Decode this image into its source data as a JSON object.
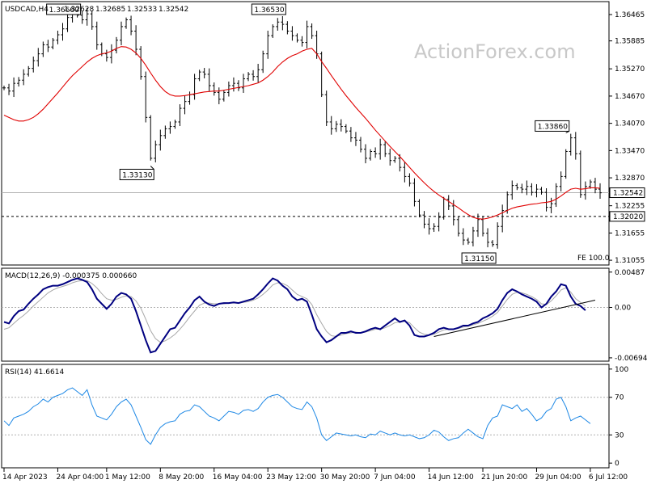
{
  "chart_data": [
    {
      "type": "line",
      "panel": "price",
      "title": "USDCAD,H4",
      "ohlc": [
        "1.32628",
        "1.32685",
        "1.32533",
        "1.32542"
      ],
      "watermark": "ActionForex.com",
      "ylim": [
        1.3095,
        1.3675
      ],
      "y_ticks": [
        "1.36465",
        "1.35885",
        "1.35270",
        "1.34670",
        "1.34070",
        "1.33470",
        "1.32870",
        "1.32255",
        "1.31655",
        "1.31055"
      ],
      "y_tick_values": [
        1.36465,
        1.35885,
        1.3527,
        1.3467,
        1.3407,
        1.3347,
        1.3287,
        1.32255,
        1.31655,
        1.31055
      ],
      "current_label": "1.32542",
      "current_value": 1.32542,
      "level_label": "1.32020",
      "level_value": 1.3202,
      "fib_label": "FE 100.0",
      "annotations": [
        {
          "text": "1.36660",
          "i": 15,
          "value": 1.3666,
          "side": "high"
        },
        {
          "text": "1.33130",
          "i": 30,
          "value": 1.3313,
          "side": "low"
        },
        {
          "text": "1.36530",
          "i": 57,
          "value": 1.3653,
          "side": "high"
        },
        {
          "text": "1.31150",
          "i": 100,
          "value": 1.3115,
          "side": "low"
        },
        {
          "text": "1.33860",
          "i": 115,
          "value": 1.3386,
          "side": "high"
        }
      ],
      "x_labels": [
        "14 Apr 2023",
        "24 Apr 04:00",
        "1 May 12:00",
        "8 May 20:00",
        "16 May 04:00",
        "23 May 12:00",
        "30 May 20:00",
        "7 Jun 04:00",
        "14 Jun 12:00",
        "21 Jun 20:00",
        "29 Jun 04:00",
        "6 Jul 12:00"
      ],
      "x_label_index": [
        0,
        11,
        21,
        32,
        43,
        54,
        65,
        76,
        87,
        98,
        109,
        120
      ],
      "close": [
        1.3485,
        1.3478,
        1.3495,
        1.3502,
        1.3515,
        1.3528,
        1.3545,
        1.356,
        1.358,
        1.3575,
        1.359,
        1.3602,
        1.3615,
        1.364,
        1.3652,
        1.3645,
        1.3635,
        1.3648,
        1.362,
        1.358,
        1.356,
        1.3552,
        1.3568,
        1.359,
        1.362,
        1.3635,
        1.361,
        1.357,
        1.351,
        1.342,
        1.333,
        1.336,
        1.338,
        1.3395,
        1.34,
        1.341,
        1.344,
        1.3455,
        1.347,
        1.3505,
        1.352,
        1.3515,
        1.349,
        1.3475,
        1.346,
        1.3475,
        1.349,
        1.3495,
        1.3485,
        1.3505,
        1.3515,
        1.351,
        1.3525,
        1.356,
        1.36,
        1.362,
        1.363,
        1.3625,
        1.361,
        1.36,
        1.359,
        1.3585,
        1.362,
        1.36,
        1.356,
        1.347,
        1.341,
        1.3395,
        1.3405,
        1.34,
        1.339,
        1.3375,
        1.337,
        1.335,
        1.333,
        1.3345,
        1.334,
        1.336,
        1.334,
        1.3325,
        1.333,
        1.331,
        1.329,
        1.3275,
        1.3235,
        1.3205,
        1.3185,
        1.3175,
        1.318,
        1.32,
        1.324,
        1.3225,
        1.3195,
        1.3165,
        1.315,
        1.3145,
        1.317,
        1.3195,
        1.3165,
        1.3145,
        1.314,
        1.318,
        1.3215,
        1.325,
        1.327,
        1.3265,
        1.3262,
        1.3268,
        1.3255,
        1.3262,
        1.3255,
        1.3222,
        1.323,
        1.3268,
        1.329,
        1.3345,
        1.3375,
        1.334,
        1.325,
        1.3268,
        1.3278,
        1.3262,
        1.3254
      ],
      "ma": [
        1.3425,
        1.342,
        1.3415,
        1.3412,
        1.3412,
        1.3415,
        1.342,
        1.3428,
        1.3438,
        1.345,
        1.3462,
        1.3474,
        1.3487,
        1.35,
        1.3512,
        1.3522,
        1.3532,
        1.3542,
        1.355,
        1.3556,
        1.356,
        1.3562,
        1.3566,
        1.3572,
        1.3576,
        1.3575,
        1.357,
        1.3562,
        1.355,
        1.3535,
        1.3518,
        1.3502,
        1.3488,
        1.3477,
        1.347,
        1.3467,
        1.3467,
        1.3468,
        1.347,
        1.3472,
        1.3474,
        1.3476,
        1.3477,
        1.3478,
        1.3478,
        1.348,
        1.3482,
        1.3484,
        1.3486,
        1.3488,
        1.349,
        1.3493,
        1.3496,
        1.3502,
        1.351,
        1.352,
        1.3532,
        1.3542,
        1.355,
        1.3556,
        1.356,
        1.3566,
        1.357,
        1.3572,
        1.356,
        1.3543,
        1.3528,
        1.3512,
        1.3497,
        1.3482,
        1.3468,
        1.3455,
        1.3442,
        1.343,
        1.3418,
        1.3405,
        1.3392,
        1.338,
        1.3368,
        1.3356,
        1.3345,
        1.3334,
        1.3322,
        1.331,
        1.3298,
        1.3287,
        1.3276,
        1.3266,
        1.3257,
        1.3249,
        1.3242,
        1.3235,
        1.3228,
        1.3221,
        1.3213,
        1.3206,
        1.32,
        1.3197,
        1.3196,
        1.3198,
        1.3201,
        1.3205,
        1.321,
        1.3215,
        1.322,
        1.3223,
        1.3225,
        1.3227,
        1.3229,
        1.323,
        1.3232,
        1.3233,
        1.3235,
        1.324,
        1.3247,
        1.3255,
        1.3262,
        1.3264,
        1.3262,
        1.3263,
        1.3265,
        1.3265,
        1.3264
      ]
    },
    {
      "type": "line",
      "panel": "macd",
      "title": "MACD(12,26,9) -0.000375 0.000660",
      "ylim": [
        -0.0074,
        0.0054
      ],
      "y_ticks": [
        "0.00487",
        "0.00",
        "-0.006945"
      ],
      "y_tick_values": [
        0.00487,
        0.0,
        -0.006945
      ],
      "series": [
        {
          "values": [
            -0.002,
            -0.0022,
            -0.0012,
            -0.0005,
            -0.0003,
            0.0005,
            0.0012,
            0.0018,
            0.0025,
            0.0028,
            0.003,
            0.003,
            0.0032,
            0.0035,
            0.0038,
            0.004,
            0.0038,
            0.0035,
            0.0025,
            0.0012,
            0.0005,
            -0.0002,
            0.0005,
            0.0015,
            0.002,
            0.0018,
            0.0012,
            -0.0005,
            -0.0025,
            -0.0045,
            -0.0062,
            -0.006,
            -0.005,
            -0.004,
            -0.003,
            -0.0028,
            -0.0018,
            -0.0008,
            0.0,
            0.001,
            0.0015,
            0.0008,
            0.0004,
            0.0002,
            0.0005,
            0.0006,
            0.0006,
            0.0007,
            0.0006,
            0.0008,
            0.001,
            0.0012,
            0.0018,
            0.0025,
            0.0033,
            0.004,
            0.0037,
            0.003,
            0.0025,
            0.0015,
            0.001,
            0.0012,
            0.0008,
            -0.001,
            -0.003,
            -0.004,
            -0.0048,
            -0.0045,
            -0.004,
            -0.0035,
            -0.0035,
            -0.0033,
            -0.0035,
            -0.0035,
            -0.0033,
            -0.003,
            -0.0028,
            -0.003,
            -0.0025,
            -0.002,
            -0.0015,
            -0.002,
            -0.0018,
            -0.0025,
            -0.0038,
            -0.004,
            -0.004,
            -0.0038,
            -0.0035,
            -0.003,
            -0.0028,
            -0.003,
            -0.003,
            -0.0028,
            -0.0025,
            -0.0025,
            -0.0022,
            -0.002,
            -0.0015,
            -0.0012,
            -0.0008,
            -0.0002,
            0.001,
            0.002,
            0.0025,
            0.0022,
            0.0018,
            0.0015,
            0.0012,
            0.0008,
            0.0,
            0.0005,
            0.0015,
            0.0022,
            0.0032,
            0.003,
            0.0015,
            0.0005,
            0.0002,
            -0.0004
          ],
          "color": "#000080"
        },
        {
          "values": [
            -0.003,
            -0.0028,
            -0.0022,
            -0.0016,
            -0.0011,
            -0.0005,
            0.0002,
            0.0008,
            0.0014,
            0.002,
            0.0024,
            0.0027,
            0.0029,
            0.0031,
            0.0034,
            0.0036,
            0.0037,
            0.0037,
            0.0033,
            0.0027,
            0.0019,
            0.0012,
            0.001,
            0.0011,
            0.0014,
            0.0016,
            0.0015,
            0.0009,
            -0.0001,
            -0.0016,
            -0.0032,
            -0.0043,
            -0.0048,
            -0.0046,
            -0.0042,
            -0.0037,
            -0.003,
            -0.0022,
            -0.0013,
            -0.0005,
            0.0003,
            0.0006,
            0.0006,
            0.0005,
            0.0005,
            0.0005,
            0.0006,
            0.0006,
            0.0006,
            0.0007,
            0.0008,
            0.001,
            0.0013,
            0.0018,
            0.0024,
            0.0031,
            0.0034,
            0.0033,
            0.003,
            0.0024,
            0.0018,
            0.0015,
            0.0012,
            0.0004,
            -0.001,
            -0.0022,
            -0.0033,
            -0.0039,
            -0.004,
            -0.0038,
            -0.0036,
            -0.0035,
            -0.0034,
            -0.0035,
            -0.0034,
            -0.0032,
            -0.003,
            -0.003,
            -0.0028,
            -0.0025,
            -0.0021,
            -0.002,
            -0.0019,
            -0.0021,
            -0.0028,
            -0.0034,
            -0.0037,
            -0.0038,
            -0.0037,
            -0.0034,
            -0.0031,
            -0.003,
            -0.003,
            -0.0029,
            -0.0027,
            -0.0026,
            -0.0024,
            -0.0022,
            -0.0019,
            -0.0016,
            -0.0012,
            -0.0007,
            0.0002,
            0.0011,
            0.0018,
            0.0021,
            0.002,
            0.0018,
            0.0015,
            0.0011,
            0.0005,
            0.0004,
            0.0009,
            0.0016,
            0.0024,
            0.0027,
            0.0021,
            0.0012,
            0.0007,
            0.0002
          ],
          "color": "#a8a8a8"
        }
      ],
      "trendline": {
        "i1": 88,
        "v1": -0.004,
        "i2": 121,
        "v2": 0.001
      }
    },
    {
      "type": "line",
      "panel": "rsi",
      "title": "RSI(14) 41.6614",
      "ylim": [
        0,
        100
      ],
      "y_ticks": [
        "100",
        "70",
        "30",
        "0"
      ],
      "y_tick_values": [
        100,
        70,
        30,
        0
      ],
      "levels": [
        70,
        30
      ],
      "values": [
        45,
        40,
        48,
        50,
        52,
        55,
        60,
        63,
        68,
        65,
        70,
        72,
        74,
        78,
        80,
        76,
        72,
        78,
        62,
        50,
        48,
        46,
        52,
        60,
        65,
        68,
        62,
        50,
        38,
        25,
        20,
        30,
        38,
        42,
        44,
        45,
        52,
        55,
        56,
        62,
        60,
        55,
        50,
        48,
        45,
        50,
        55,
        54,
        52,
        56,
        57,
        55,
        58,
        65,
        70,
        72,
        73,
        70,
        65,
        60,
        58,
        57,
        65,
        60,
        48,
        30,
        24,
        28,
        32,
        31,
        30,
        29,
        30,
        28,
        27,
        31,
        30,
        34,
        32,
        30,
        32,
        30,
        29,
        30,
        28,
        26,
        27,
        30,
        35,
        33,
        28,
        24,
        26,
        27,
        32,
        36,
        32,
        28,
        26,
        40,
        48,
        50,
        62,
        60,
        58,
        62,
        55,
        58,
        52,
        45,
        48,
        55,
        58,
        68,
        70,
        60,
        45,
        48,
        50,
        46,
        42
      ],
      "color": "#1e88e5"
    }
  ]
}
